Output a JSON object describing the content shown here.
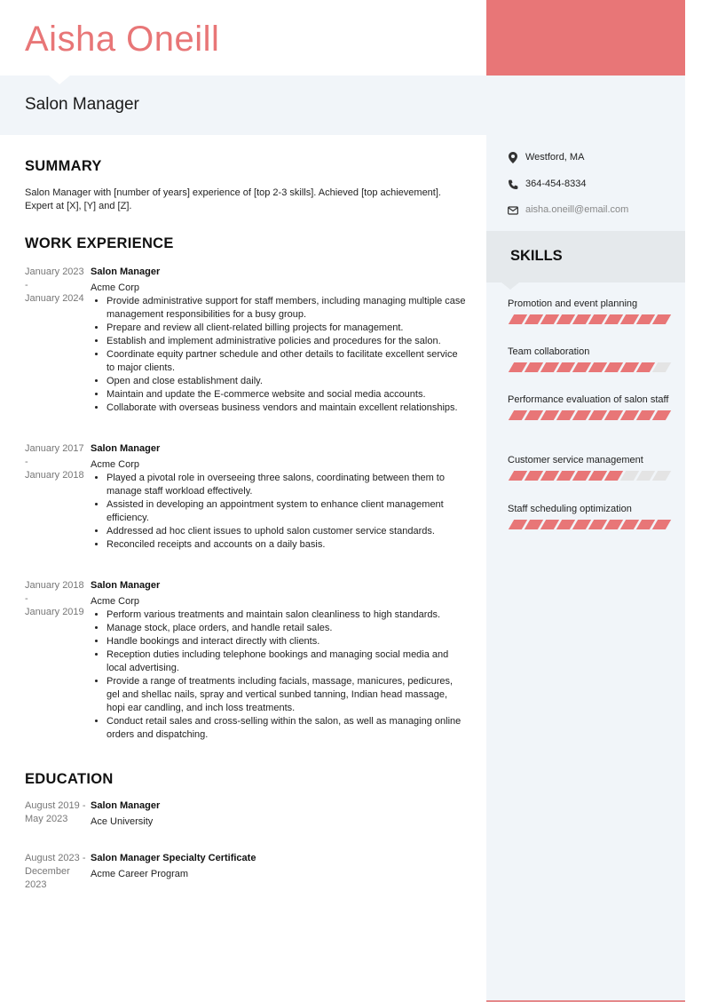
{
  "header": {
    "name": "Aisha Oneill",
    "job_title": "Salon Manager"
  },
  "colors": {
    "accent": "#e87677",
    "band": "#f1f5f9",
    "skills_band": "#e5e9ec",
    "segment_off": "#e4e4e4"
  },
  "contact": {
    "location": "Westford, MA",
    "phone": "364-454-8334",
    "email": "aisha.oneill@email.com",
    "icons": {
      "location": "map-pin-icon",
      "phone": "phone-icon",
      "email": "envelope-icon"
    }
  },
  "summary": {
    "heading": "SUMMARY",
    "text": "Salon Manager with [number of years] experience of [top 2-3 skills]. Achieved [top achievement]. Expert at [X], [Y] and [Z]."
  },
  "work": {
    "heading": "WORK EXPERIENCE",
    "entries": [
      {
        "start": "January 2023",
        "separator": "-",
        "end": "January 2024",
        "role": "Salon Manager",
        "org": "Acme Corp",
        "bullets": [
          "Provide administrative support for staff members, including managing multiple case management responsibilities for a busy group.",
          "Prepare and review all client-related billing projects for management.",
          "Establish and implement administrative policies and procedures for the salon.",
          "Coordinate equity partner schedule and other details to facilitate excellent service to major clients.",
          "Open and close establishment daily.",
          "Maintain and update the E-commerce website and social media accounts.",
          "Collaborate with overseas business vendors and maintain excellent relationships."
        ]
      },
      {
        "start": "January 2017",
        "separator": "-",
        "end": "January 2018",
        "role": "Salon Manager",
        "org": "Acme Corp",
        "bullets": [
          "Played a pivotal role in overseeing three salons, coordinating between them to manage staff workload effectively.",
          "Assisted in developing an appointment system to enhance client management efficiency.",
          "Addressed ad hoc client issues to uphold salon customer service standards.",
          "Reconciled receipts and accounts on a daily basis."
        ]
      },
      {
        "start": "January 2018",
        "separator": "-",
        "end": "January 2019",
        "role": "Salon Manager",
        "org": "Acme Corp",
        "bullets": [
          "Perform various treatments and maintain salon cleanliness to high standards.",
          "Manage stock, place orders, and handle retail sales.",
          "Handle bookings and interact directly with clients.",
          "Reception duties including telephone bookings and managing social media and local advertising.",
          "Provide a range of treatments including facials, massage, manicures, pedicures, gel and shellac nails, spray and vertical sunbed tanning, Indian head massage, hopi ear candling, and inch loss treatments.",
          "Conduct retail sales and cross-selling within the salon, as well as managing online orders and dispatching."
        ]
      }
    ]
  },
  "education": {
    "heading": "EDUCATION",
    "entries": [
      {
        "dates": "August 2019 - May 2023",
        "degree": "Salon Manager",
        "school": "Ace University"
      },
      {
        "dates": "August 2023 - December 2023",
        "degree": "Salon Manager Specialty Certificate",
        "school": "Acme Career Program"
      }
    ]
  },
  "skills": {
    "heading": "SKILLS",
    "max_level": 10,
    "items": [
      {
        "label": "Promotion and event planning",
        "level": 10
      },
      {
        "label": "Team collaboration",
        "level": 9
      },
      {
        "label": "Performance evaluation of salon staff",
        "level": 10
      },
      {
        "label": "Customer service management",
        "level": 7
      },
      {
        "label": "Staff scheduling optimization",
        "level": 10
      }
    ]
  }
}
